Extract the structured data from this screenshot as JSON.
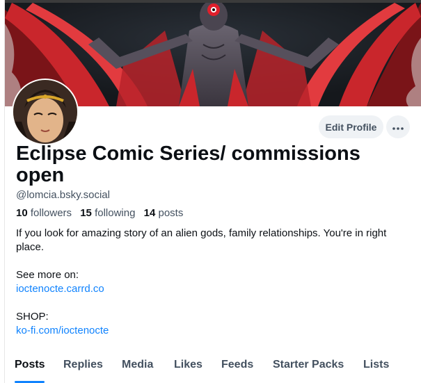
{
  "profile": {
    "display_name": "Eclipse Comic Series/ commissions open",
    "handle": "@lomcia.bsky.social",
    "followers_count": "10",
    "followers_label": "followers",
    "following_count": "15",
    "following_label": "following",
    "posts_count": "14",
    "posts_label": "posts"
  },
  "actions": {
    "edit_profile": "Edit Profile",
    "more_icon": "ellipsis-icon"
  },
  "bio": {
    "line1": "If you look for amazing story of an alien gods, family relationships. You're in right place.",
    "see_more": "See more on:",
    "link1": "ioctenocte.carrd.co",
    "shop": "SHOP:",
    "link2": "ko-fi.com/ioctenocte"
  },
  "tabs": [
    {
      "label": "Posts",
      "active": true
    },
    {
      "label": "Replies"
    },
    {
      "label": "Media"
    },
    {
      "label": "Likes"
    },
    {
      "label": "Feeds"
    },
    {
      "label": "Starter Packs"
    },
    {
      "label": "Lists"
    }
  ],
  "colors": {
    "accent": "#1083fe",
    "text": "#0b0f14",
    "muted": "#43505f",
    "button_bg": "#eff2f5"
  }
}
